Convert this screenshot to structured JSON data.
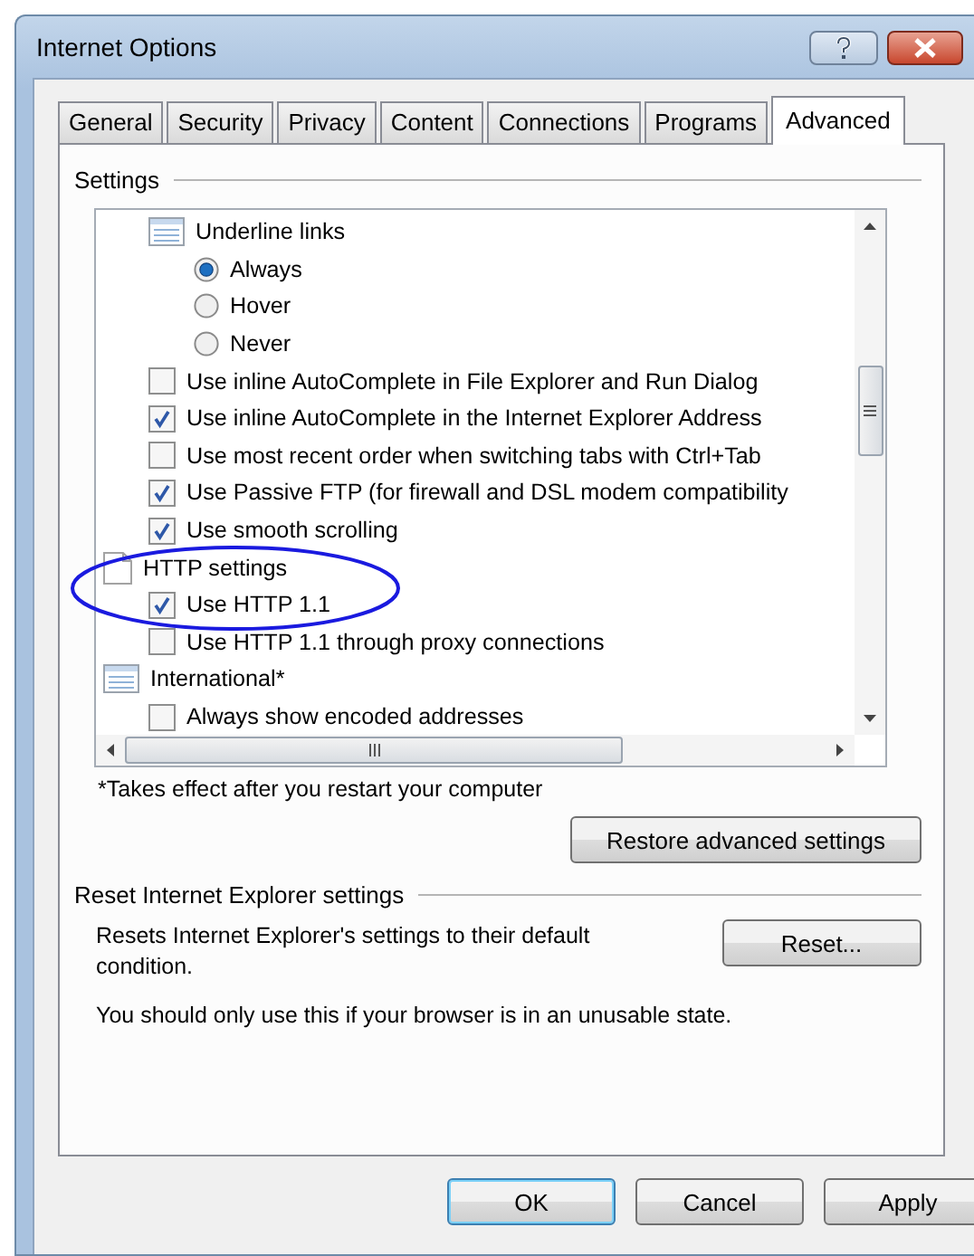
{
  "window": {
    "title": "Internet Options"
  },
  "tabs": [
    {
      "label": "General",
      "selected": false
    },
    {
      "label": "Security",
      "selected": false
    },
    {
      "label": "Privacy",
      "selected": false
    },
    {
      "label": "Content",
      "selected": false
    },
    {
      "label": "Connections",
      "selected": false
    },
    {
      "label": "Programs",
      "selected": false
    },
    {
      "label": "Advanced",
      "selected": true
    }
  ],
  "settings": {
    "title": "Settings",
    "tree": [
      {
        "children": [
          {
            "kind": "listgroup",
            "label": "Underline links",
            "children": [
              {
                "kind": "radio",
                "label": "Always",
                "selected": true
              },
              {
                "kind": "radio",
                "label": "Hover",
                "selected": false
              },
              {
                "kind": "radio",
                "label": "Never",
                "selected": false
              }
            ]
          },
          {
            "kind": "checkbox",
            "label": "Use inline AutoComplete in File Explorer and Run Dialog",
            "checked": false
          },
          {
            "kind": "checkbox",
            "label": "Use inline AutoComplete in the Internet Explorer Address",
            "checked": true
          },
          {
            "kind": "checkbox",
            "label": "Use most recent order when switching tabs with Ctrl+Tab",
            "checked": false
          },
          {
            "kind": "checkbox",
            "label": "Use Passive FTP (for firewall and DSL modem compatibility",
            "checked": true
          },
          {
            "kind": "checkbox",
            "label": "Use smooth scrolling",
            "checked": true
          }
        ]
      },
      {
        "kind": "pagegroup",
        "label": "HTTP settings",
        "children": [
          {
            "kind": "checkbox",
            "label": "Use HTTP 1.1",
            "checked": true
          },
          {
            "kind": "checkbox",
            "label": "Use HTTP 1.1 through proxy connections",
            "checked": false
          }
        ]
      },
      {
        "kind": "listgroup",
        "label": "International*",
        "children": [
          {
            "kind": "checkbox",
            "label": "Always show encoded addresses",
            "checked": false
          }
        ]
      }
    ],
    "footnote": "*Takes effect after you restart your computer",
    "restore_button": "Restore advanced settings"
  },
  "reset": {
    "title": "Reset Internet Explorer settings",
    "description": "Resets Internet Explorer's settings to their default condition.",
    "button": "Reset...",
    "warning": "You should only use this if your browser is in an unusable state."
  },
  "buttons": [
    {
      "label": "OK",
      "default": true
    },
    {
      "label": "Cancel",
      "default": false
    },
    {
      "label": "Apply",
      "default": false
    }
  ]
}
